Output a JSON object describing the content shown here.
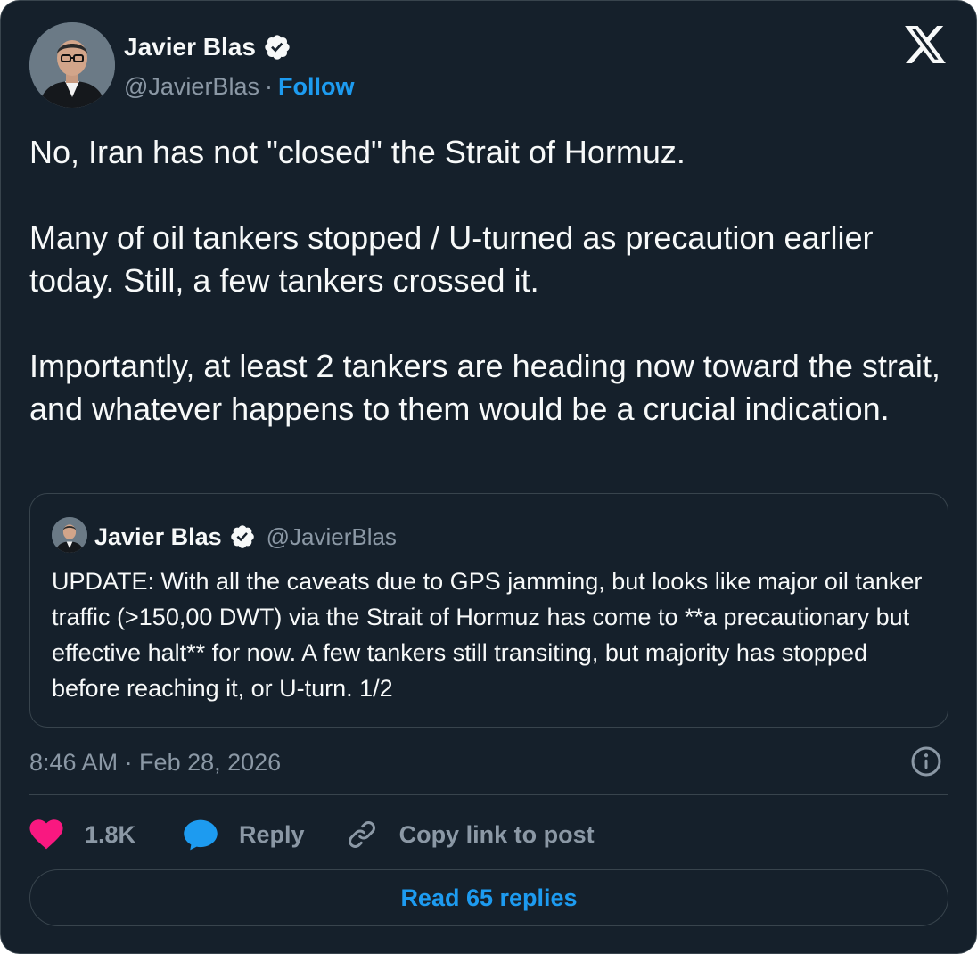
{
  "author": {
    "name": "Javier Blas",
    "handle": "@JavierBlas",
    "separator": "·",
    "follow_label": "Follow"
  },
  "tweet": {
    "text": "No, Iran has not \"closed\" the Strait of Hormuz.\n\nMany of oil tankers stopped / U-turned as precaution earlier today. Still, a few tankers crossed it.\n\nImportantly, at least 2 tankers are heading now toward the strait, and whatever happens to them would be a crucial indication."
  },
  "quote": {
    "name": "Javier Blas",
    "handle": "@JavierBlas",
    "text": "UPDATE: With all the caveats due to GPS jamming, but looks like major oil tanker traffic (>150,00 DWT) via the Strait of Hormuz has come to **a precautionary but effective halt** for now. A few tankers still transiting, but majority has stopped before reaching it, or U-turn. 1/2"
  },
  "meta": {
    "timestamp": "8:46 AM · Feb 28, 2026"
  },
  "actions": {
    "likes": "1.8K",
    "reply": "Reply",
    "copy_link": "Copy link to post"
  },
  "footer": {
    "read_replies": "Read 65 replies"
  },
  "colors": {
    "background": "#15202b",
    "border": "#38444d",
    "accent": "#1d9bf0",
    "like": "#f91880",
    "muted": "#8b98a5"
  },
  "icons": [
    "verified-badge-icon",
    "x-logo-icon",
    "info-icon",
    "heart-icon",
    "reply-bubble-icon",
    "link-icon"
  ]
}
